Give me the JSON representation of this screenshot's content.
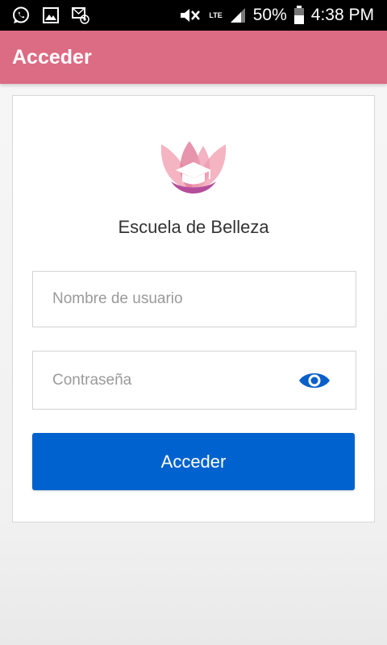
{
  "status_bar": {
    "battery": "50%",
    "time": "4:38 PM",
    "network": "LTE",
    "icons": [
      "whatsapp-icon",
      "gallery-icon",
      "email-icon",
      "mute-icon",
      "lte-icon",
      "signal-icon",
      "battery-icon"
    ]
  },
  "app_bar": {
    "title": "Acceder",
    "color": "#dc6b84"
  },
  "login": {
    "school_name": "Escuela de Belleza",
    "username_placeholder": "Nombre de usuario",
    "password_placeholder": "Contraseña",
    "submit_label": "Acceder",
    "button_color": "#0062cf",
    "icons": [
      "logo-icon",
      "eye-icon"
    ]
  }
}
